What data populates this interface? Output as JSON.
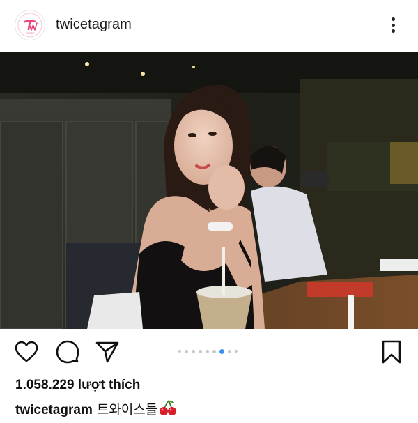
{
  "header": {
    "username": "twicetagram",
    "avatar_text": "TWICE",
    "menu_icon": "more-vertical-icon"
  },
  "photo": {
    "alt": "",
    "carousel": {
      "count": 9,
      "active_index": 6
    }
  },
  "actions": {
    "like_icon": "heart-icon",
    "comment_icon": "comment-icon",
    "share_icon": "send-icon",
    "save_icon": "bookmark-icon"
  },
  "likes": {
    "text": "1.058.229 lượt thích"
  },
  "caption": {
    "username": "twicetagram",
    "text": "트와이스들",
    "emoji_icon": "cherry-icon"
  },
  "colors": {
    "accent": "#3b90f0",
    "text": "#111111",
    "logo_pink": "#e8457a"
  }
}
